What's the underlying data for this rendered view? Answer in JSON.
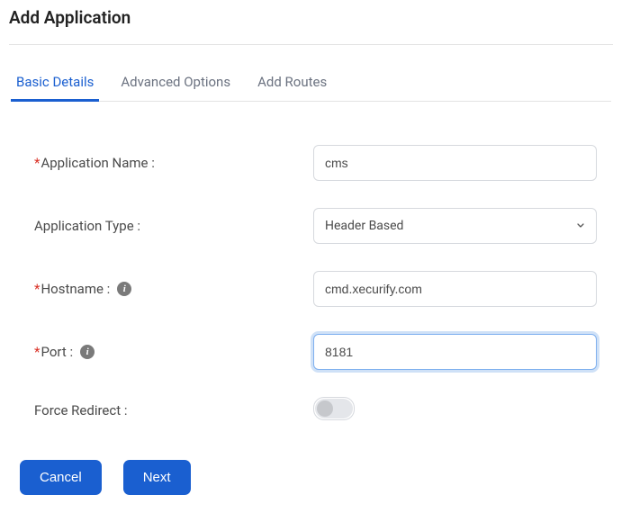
{
  "title": "Add Application",
  "tabs": {
    "basic": "Basic Details",
    "advanced": "Advanced Options",
    "routes": "Add Routes"
  },
  "fields": {
    "appName": {
      "label": "Application Name :",
      "value": "cms"
    },
    "appType": {
      "label": "Application Type :",
      "value": "Header Based"
    },
    "hostname": {
      "label": "Hostname :",
      "value": "cmd.xecurify.com"
    },
    "port": {
      "label": "Port :",
      "value": "8181"
    },
    "forceRedirect": {
      "label": "Force Redirect :",
      "value": false
    }
  },
  "buttons": {
    "cancel": "Cancel",
    "next": "Next"
  }
}
